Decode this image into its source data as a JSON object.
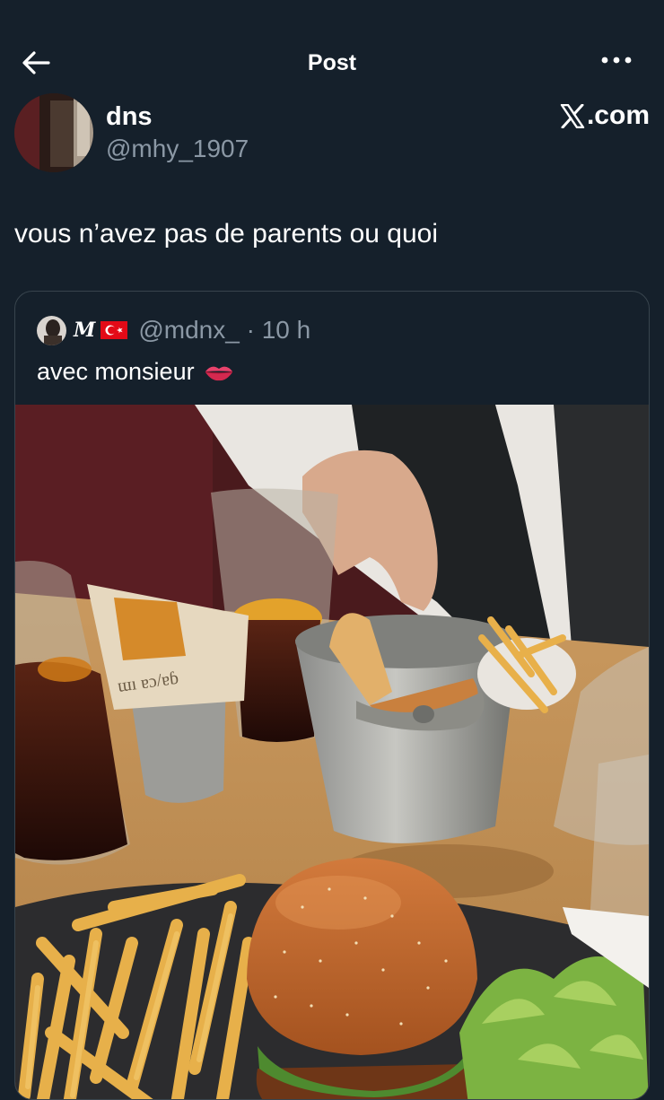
{
  "header": {
    "title": "Post",
    "back_icon": "arrow-left-icon",
    "more_icon": "more-horizontal-icon"
  },
  "author": {
    "display_name": "dns",
    "handle": "@mhy_1907",
    "brand_text": ".com"
  },
  "post": {
    "text": "vous n’avez pas de parents ou quoi"
  },
  "quoted": {
    "display_name": "M",
    "flag": "turkey-flag",
    "handle": "@mdnx_",
    "separator": " · ",
    "time": "10 h",
    "text": "avec monsieur",
    "emoji": "lips-emoji"
  },
  "colors": {
    "background": "#15202b",
    "secondary_text": "#8b98a5",
    "border": "#38444d"
  }
}
